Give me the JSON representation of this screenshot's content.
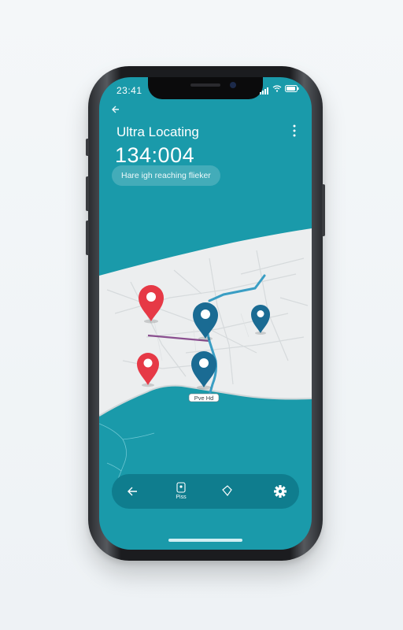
{
  "status": {
    "time": "23:41"
  },
  "header": {
    "title": "Ultra Locating",
    "number": "134:004",
    "pill_text": "Hare igh reaching flieker"
  },
  "map": {
    "road_label": "Pve Hd"
  },
  "colors": {
    "screen": "#1a9aaa",
    "pin_red": "#e63946",
    "pin_blue": "#1a6b93",
    "route": "#3a9ec4",
    "route_purple": "#8a4f8f"
  },
  "nav": {
    "items": [
      {
        "icon": "back-arrow-icon"
      },
      {
        "icon": "lock-icon",
        "label": "Piss"
      },
      {
        "icon": "tag-icon"
      },
      {
        "icon": "gear-icon"
      }
    ]
  }
}
